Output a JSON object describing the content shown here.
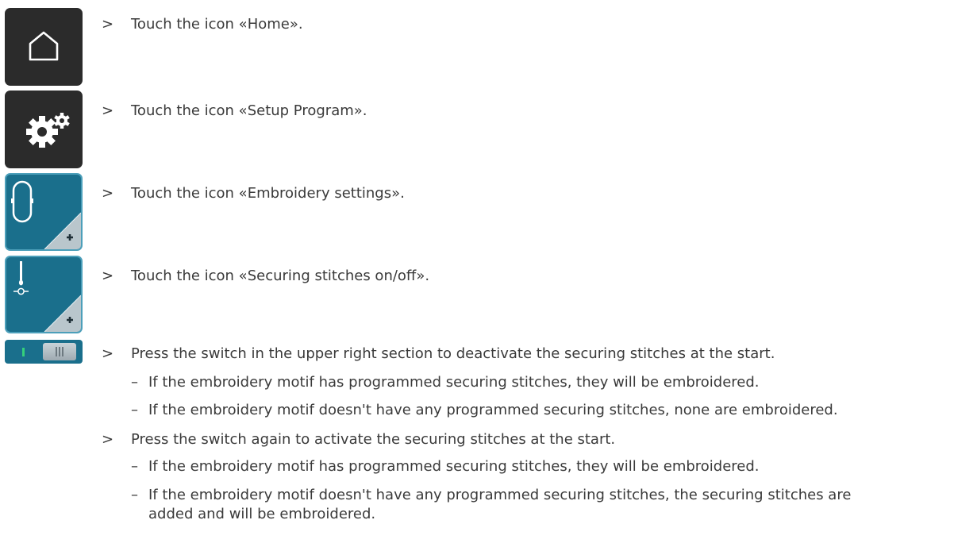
{
  "icons": [
    {
      "name": "home-icon"
    },
    {
      "name": "setup-program-icon"
    },
    {
      "name": "embroidery-settings-icon"
    },
    {
      "name": "securing-stitches-icon"
    },
    {
      "name": "securing-switch-icon"
    }
  ],
  "colors": {
    "dark_icon_bg": "#2b2b2b",
    "teal_icon_bg": "#1a6f8c",
    "teal_icon_border": "#4c9fba",
    "switch_on": "#35d07b",
    "text": "#3a3a3a"
  },
  "markers": {
    "step": ">",
    "sub": "–"
  },
  "steps": [
    {
      "text": "Touch the icon «Home»."
    },
    {
      "text": "Touch the icon «Setup Program»."
    },
    {
      "text": "Touch the icon «Embroidery settings»."
    },
    {
      "text": "Touch the icon «Securing stitches on/off»."
    },
    {
      "text": "Press the switch in the upper right section to deactivate the securing stitches at the start.",
      "subs": [
        "If the embroidery motif has programmed securing stitches, they will be embroidered.",
        "If the embroidery motif doesn't have any programmed securing stitches, none are embroidered."
      ]
    },
    {
      "text": "Press the switch again to activate the securing stitches at the start.",
      "subs": [
        "If the embroidery motif has programmed securing stitches, they will be embroidered.",
        {
          "line1": "If the embroidery motif doesn't have any programmed securing stitches, the securing stitches are",
          "line2": "added and will be embroidered."
        }
      ]
    }
  ]
}
